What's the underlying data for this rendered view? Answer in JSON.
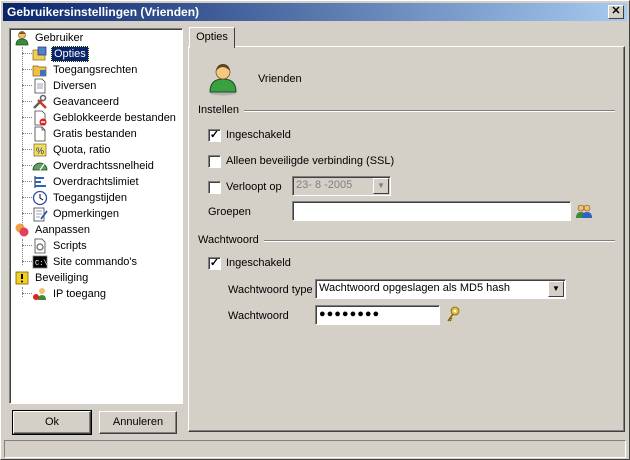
{
  "window": {
    "title": "Gebruikersinstellingen (Vrienden)",
    "close_glyph": "✕"
  },
  "tree": {
    "items": [
      {
        "label": "Gebruiker",
        "icon": "user-icon"
      },
      {
        "label": "Opties",
        "icon": "options-icon",
        "selected": true
      },
      {
        "label": "Toegangsrechten",
        "icon": "folder-rights-icon"
      },
      {
        "label": "Diversen",
        "icon": "document-icon"
      },
      {
        "label": "Geavanceerd",
        "icon": "tools-icon"
      },
      {
        "label": "Geblokkeerde bestanden",
        "icon": "blocked-file-icon"
      },
      {
        "label": "Gratis bestanden",
        "icon": "file-icon"
      },
      {
        "label": "Quota, ratio",
        "icon": "quota-icon"
      },
      {
        "label": "Overdrachtssnelheid",
        "icon": "speed-gauge-icon"
      },
      {
        "label": "Overdrachtslimiet",
        "icon": "limit-icon"
      },
      {
        "label": "Toegangstijden",
        "icon": "clock-icon"
      },
      {
        "label": "Opmerkingen",
        "icon": "notes-icon"
      },
      {
        "label": "Aanpassen",
        "icon": "customize-icon"
      },
      {
        "label": "Scripts",
        "icon": "script-icon"
      },
      {
        "label": "Site commando's",
        "icon": "console-icon"
      },
      {
        "label": "Beveiliging",
        "icon": "security-icon"
      },
      {
        "label": "IP toegang",
        "icon": "ip-access-icon"
      }
    ]
  },
  "buttons": {
    "ok": "Ok",
    "cancel": "Annuleren"
  },
  "tabs": [
    {
      "label": "Opties"
    }
  ],
  "options": {
    "group_name": "Vrienden",
    "section_settings": "Instellen",
    "enabled_label": "Ingeschakeld",
    "enabled_checked": true,
    "ssl_label": "Alleen beveiligde verbinding (SSL)",
    "ssl_checked": false,
    "expires_label": "Verloopt op",
    "expires_checked": false,
    "expires_date": "23- 8 -2005",
    "groups_label": "Groepen",
    "groups_value": "",
    "section_password": "Wachtwoord",
    "pw_enabled_label": "Ingeschakeld",
    "pw_enabled_checked": true,
    "pw_type_label": "Wachtwoord type",
    "pw_type_value": "Wachtwoord opgeslagen als MD5 hash",
    "pw_label": "Wachtwoord",
    "pw_value": "●●●●●●●●",
    "check_glyph": "✓",
    "dropdown_glyph": "▼"
  },
  "colors": {
    "title_start": "#0a246a",
    "title_end": "#a6caf0",
    "selection": "#0a246a",
    "face": "#d4d0c8"
  }
}
